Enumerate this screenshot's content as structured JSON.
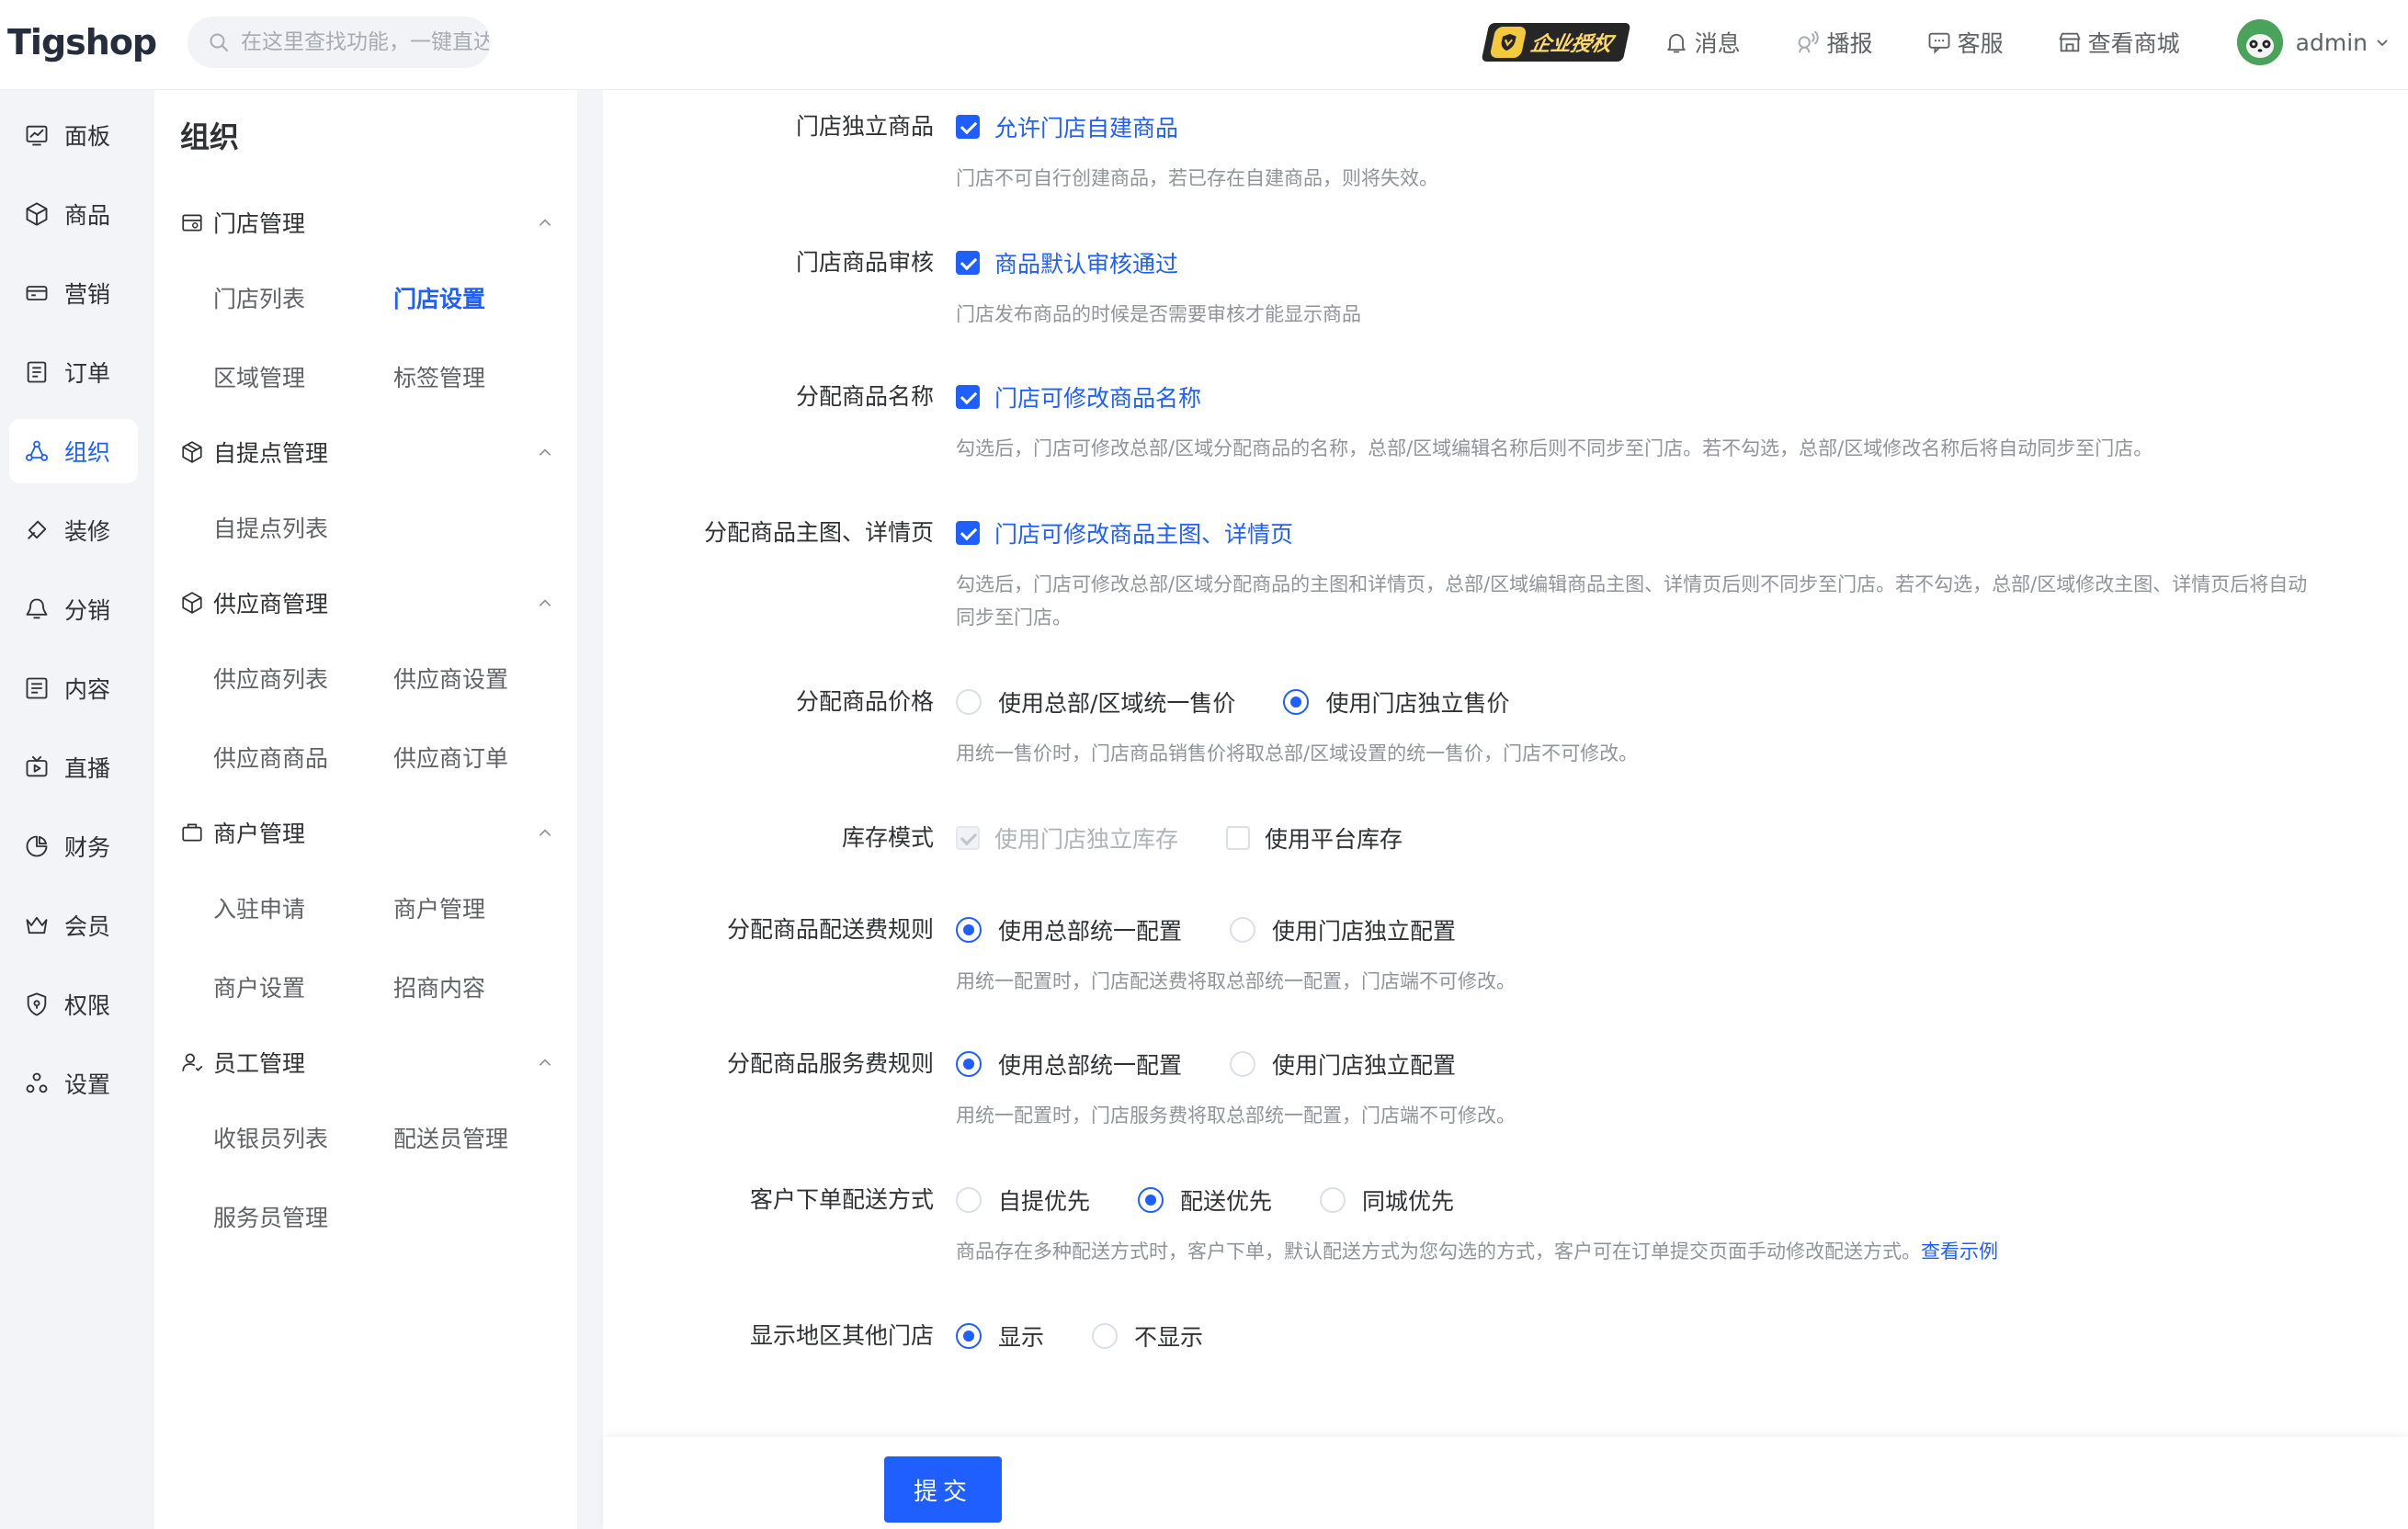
{
  "header": {
    "logo": "Tigshop",
    "search_placeholder": "在这里查找功能，一键直达",
    "license_badge": "企业授权",
    "items": [
      {
        "label": "消息",
        "icon": "bell-icon"
      },
      {
        "label": "播报",
        "icon": "broadcast-icon"
      },
      {
        "label": "客服",
        "icon": "chat-icon"
      },
      {
        "label": "查看商城",
        "icon": "store-icon"
      }
    ],
    "user": "admin"
  },
  "sidebar": {
    "items": [
      {
        "label": "面板",
        "icon": "dashboard-icon"
      },
      {
        "label": "商品",
        "icon": "product-icon"
      },
      {
        "label": "营销",
        "icon": "marketing-icon"
      },
      {
        "label": "订单",
        "icon": "order-icon"
      },
      {
        "label": "组织",
        "icon": "organization-icon",
        "active": true
      },
      {
        "label": "装修",
        "icon": "decoration-icon"
      },
      {
        "label": "分销",
        "icon": "distribution-icon"
      },
      {
        "label": "内容",
        "icon": "content-icon"
      },
      {
        "label": "直播",
        "icon": "live-icon"
      },
      {
        "label": "财务",
        "icon": "finance-icon"
      },
      {
        "label": "会员",
        "icon": "member-icon"
      },
      {
        "label": "权限",
        "icon": "permission-icon"
      },
      {
        "label": "设置",
        "icon": "settings-icon"
      }
    ]
  },
  "submenu": {
    "title": "组织",
    "groups": [
      {
        "label": "门店管理",
        "links": [
          "门店列表",
          "门店设置",
          "区域管理",
          "标签管理"
        ]
      },
      {
        "label": "自提点管理",
        "links": [
          "自提点列表"
        ]
      },
      {
        "label": "供应商管理",
        "links": [
          "供应商列表",
          "供应商设置",
          "供应商商品",
          "供应商订单"
        ]
      },
      {
        "label": "商户管理",
        "links": [
          "入驻申请",
          "商户管理",
          "商户设置",
          "招商内容"
        ]
      },
      {
        "label": "员工管理",
        "links": [
          "收银员列表",
          "配送员管理",
          "服务员管理"
        ]
      }
    ]
  },
  "form": {
    "rows": [
      {
        "label": "门店独立商品",
        "options": [
          "允许门店自建商品"
        ],
        "hint": "门店不可自行创建商品，若已存在自建商品，则将失效。"
      },
      {
        "label": "门店商品审核",
        "options": [
          "商品默认审核通过"
        ],
        "hint": "门店发布商品的时候是否需要审核才能显示商品"
      },
      {
        "label": "分配商品名称",
        "options": [
          "门店可修改商品名称"
        ],
        "hint": "勾选后，门店可修改总部/区域分配商品的名称，总部/区域编辑名称后则不同步至门店。若不勾选，总部/区域修改名称后将自动同步至门店。"
      },
      {
        "label": "分配商品主图、详情页",
        "options": [
          "门店可修改商品主图、详情页"
        ],
        "hint": "勾选后，门店可修改总部/区域分配商品的主图和详情页，总部/区域编辑商品主图、详情页后则不同步至门店。若不勾选，总部/区域修改主图、详情页后将自动同步至门店。"
      },
      {
        "label": "分配商品价格",
        "options": [
          "使用总部/区域统一售价",
          "使用门店独立售价"
        ],
        "hint": "用统一售价时，门店商品销售价将取总部/区域设置的统一售价，门店不可修改。"
      },
      {
        "label": "库存模式",
        "options": [
          "使用门店独立库存",
          "使用平台库存"
        ],
        "hint": ""
      },
      {
        "label": "分配商品配送费规则",
        "options": [
          "使用总部统一配置",
          "使用门店独立配置"
        ],
        "hint": "用统一配置时，门店配送费将取总部统一配置，门店端不可修改。"
      },
      {
        "label": "分配商品服务费规则",
        "options": [
          "使用总部统一配置",
          "使用门店独立配置"
        ],
        "hint": "用统一配置时，门店服务费将取总部统一配置，门店端不可修改。"
      },
      {
        "label": "客户下单配送方式",
        "options": [
          "自提优先",
          "配送优先",
          "同城优先"
        ],
        "hint": "商品存在多种配送方式时，客户下单，默认配送方式为您勾选的方式，客户可在订单提交页面手动修改配送方式。",
        "link": "查看示例"
      },
      {
        "label": "显示地区其他门店",
        "options": [
          "显示",
          "不显示"
        ],
        "hint": ""
      }
    ],
    "submit": "提交"
  },
  "colors": {
    "primary": "#1f5eff",
    "background": "#f2f4f8"
  }
}
